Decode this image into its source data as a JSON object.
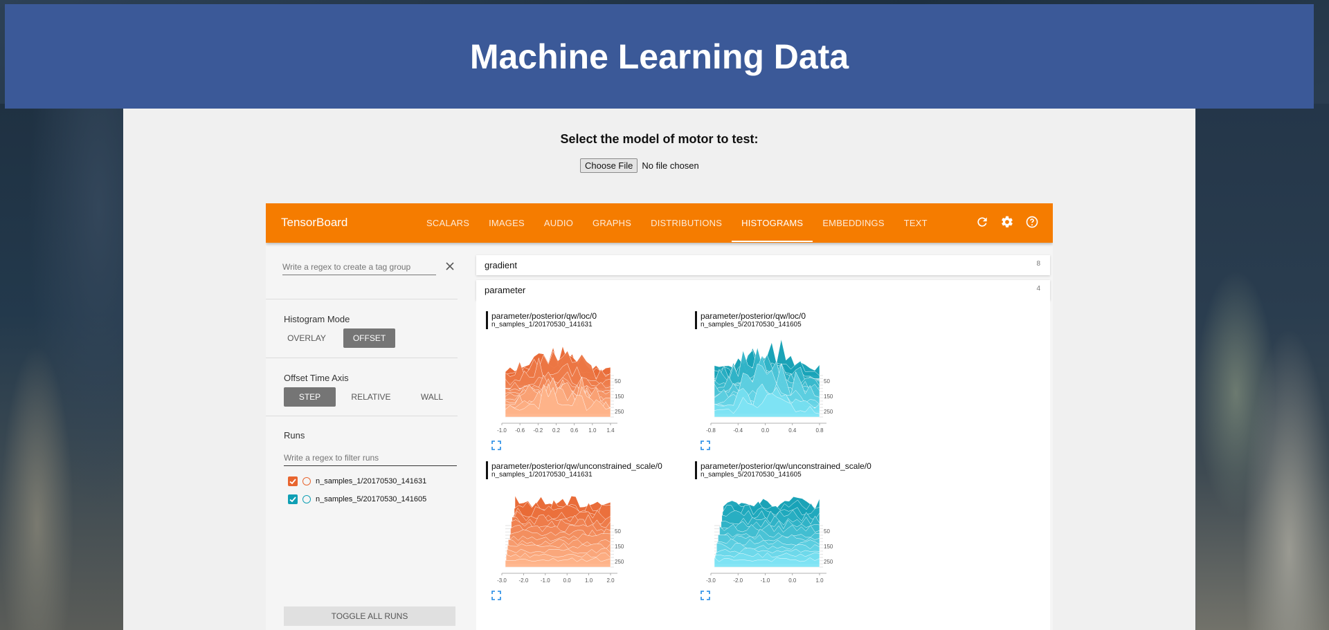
{
  "page": {
    "title": "Machine Learning Data",
    "select_label": "Select the model of motor to test:",
    "file_button": "Choose File",
    "file_status": "No file chosen"
  },
  "tensorboard": {
    "brand": "TensorBoard",
    "tabs": [
      {
        "label": "SCALARS"
      },
      {
        "label": "IMAGES"
      },
      {
        "label": "AUDIO"
      },
      {
        "label": "GRAPHS"
      },
      {
        "label": "DISTRIBUTIONS"
      },
      {
        "label": "HISTOGRAMS",
        "active": true
      },
      {
        "label": "EMBEDDINGS"
      },
      {
        "label": "TEXT"
      }
    ],
    "header_icons": [
      "refresh-icon",
      "settings-icon",
      "help-icon"
    ],
    "accent_color": "#f57c00"
  },
  "sidebar": {
    "tag_regex_placeholder": "Write a regex to create a tag group",
    "histogram_mode_label": "Histogram Mode",
    "histogram_modes": [
      "OVERLAY",
      "OFFSET"
    ],
    "histogram_mode_selected": "OFFSET",
    "time_axis_label": "Offset Time Axis",
    "time_axis_options": [
      "STEP",
      "RELATIVE",
      "WALL"
    ],
    "time_axis_selected": "STEP",
    "runs_label": "Runs",
    "runs_filter_placeholder": "Write a regex to filter runs",
    "runs": [
      {
        "name": "n_samples_1/20170530_141631",
        "checked": true,
        "color": "#e8652f"
      },
      {
        "name": "n_samples_5/20170530_141605",
        "checked": true,
        "color": "#0f9fb4"
      }
    ],
    "toggle_all_label": "TOGGLE ALL RUNS"
  },
  "groups": [
    {
      "name": "gradient",
      "count": "8"
    },
    {
      "name": "parameter",
      "count": "4"
    }
  ],
  "cards": [
    {
      "tag": "parameter/posterior/qw/loc/0",
      "run": "n_samples_1/20170530_141631",
      "color": "#e8652f",
      "x_ticks": [
        "-1.0",
        "-0.6",
        "-0.2",
        "0.2",
        "0.6",
        "1.0",
        "1.4"
      ],
      "y_ticks": [
        "50",
        "150",
        "250"
      ]
    },
    {
      "tag": "parameter/posterior/qw/loc/0",
      "run": "n_samples_5/20170530_141605",
      "color": "#0f9fb4",
      "x_ticks": [
        "-0.8",
        "-0.4",
        "0.0",
        "0.4",
        "0.8"
      ],
      "y_ticks": [
        "50",
        "150",
        "250"
      ]
    },
    {
      "tag": "parameter/posterior/qw/unconstrained_scale/0",
      "run": "n_samples_1/20170530_141631",
      "color": "#e8652f",
      "x_ticks": [
        "-3.0",
        "-2.0",
        "-1.0",
        "0.0",
        "1.0",
        "2.0"
      ],
      "y_ticks": [
        "50",
        "150",
        "250"
      ]
    },
    {
      "tag": "parameter/posterior/qw/unconstrained_scale/0",
      "run": "n_samples_5/20170530_141605",
      "color": "#0f9fb4",
      "x_ticks": [
        "-3.0",
        "-2.0",
        "-1.0",
        "0.0",
        "1.0"
      ],
      "y_ticks": [
        "50",
        "150",
        "250"
      ]
    }
  ]
}
